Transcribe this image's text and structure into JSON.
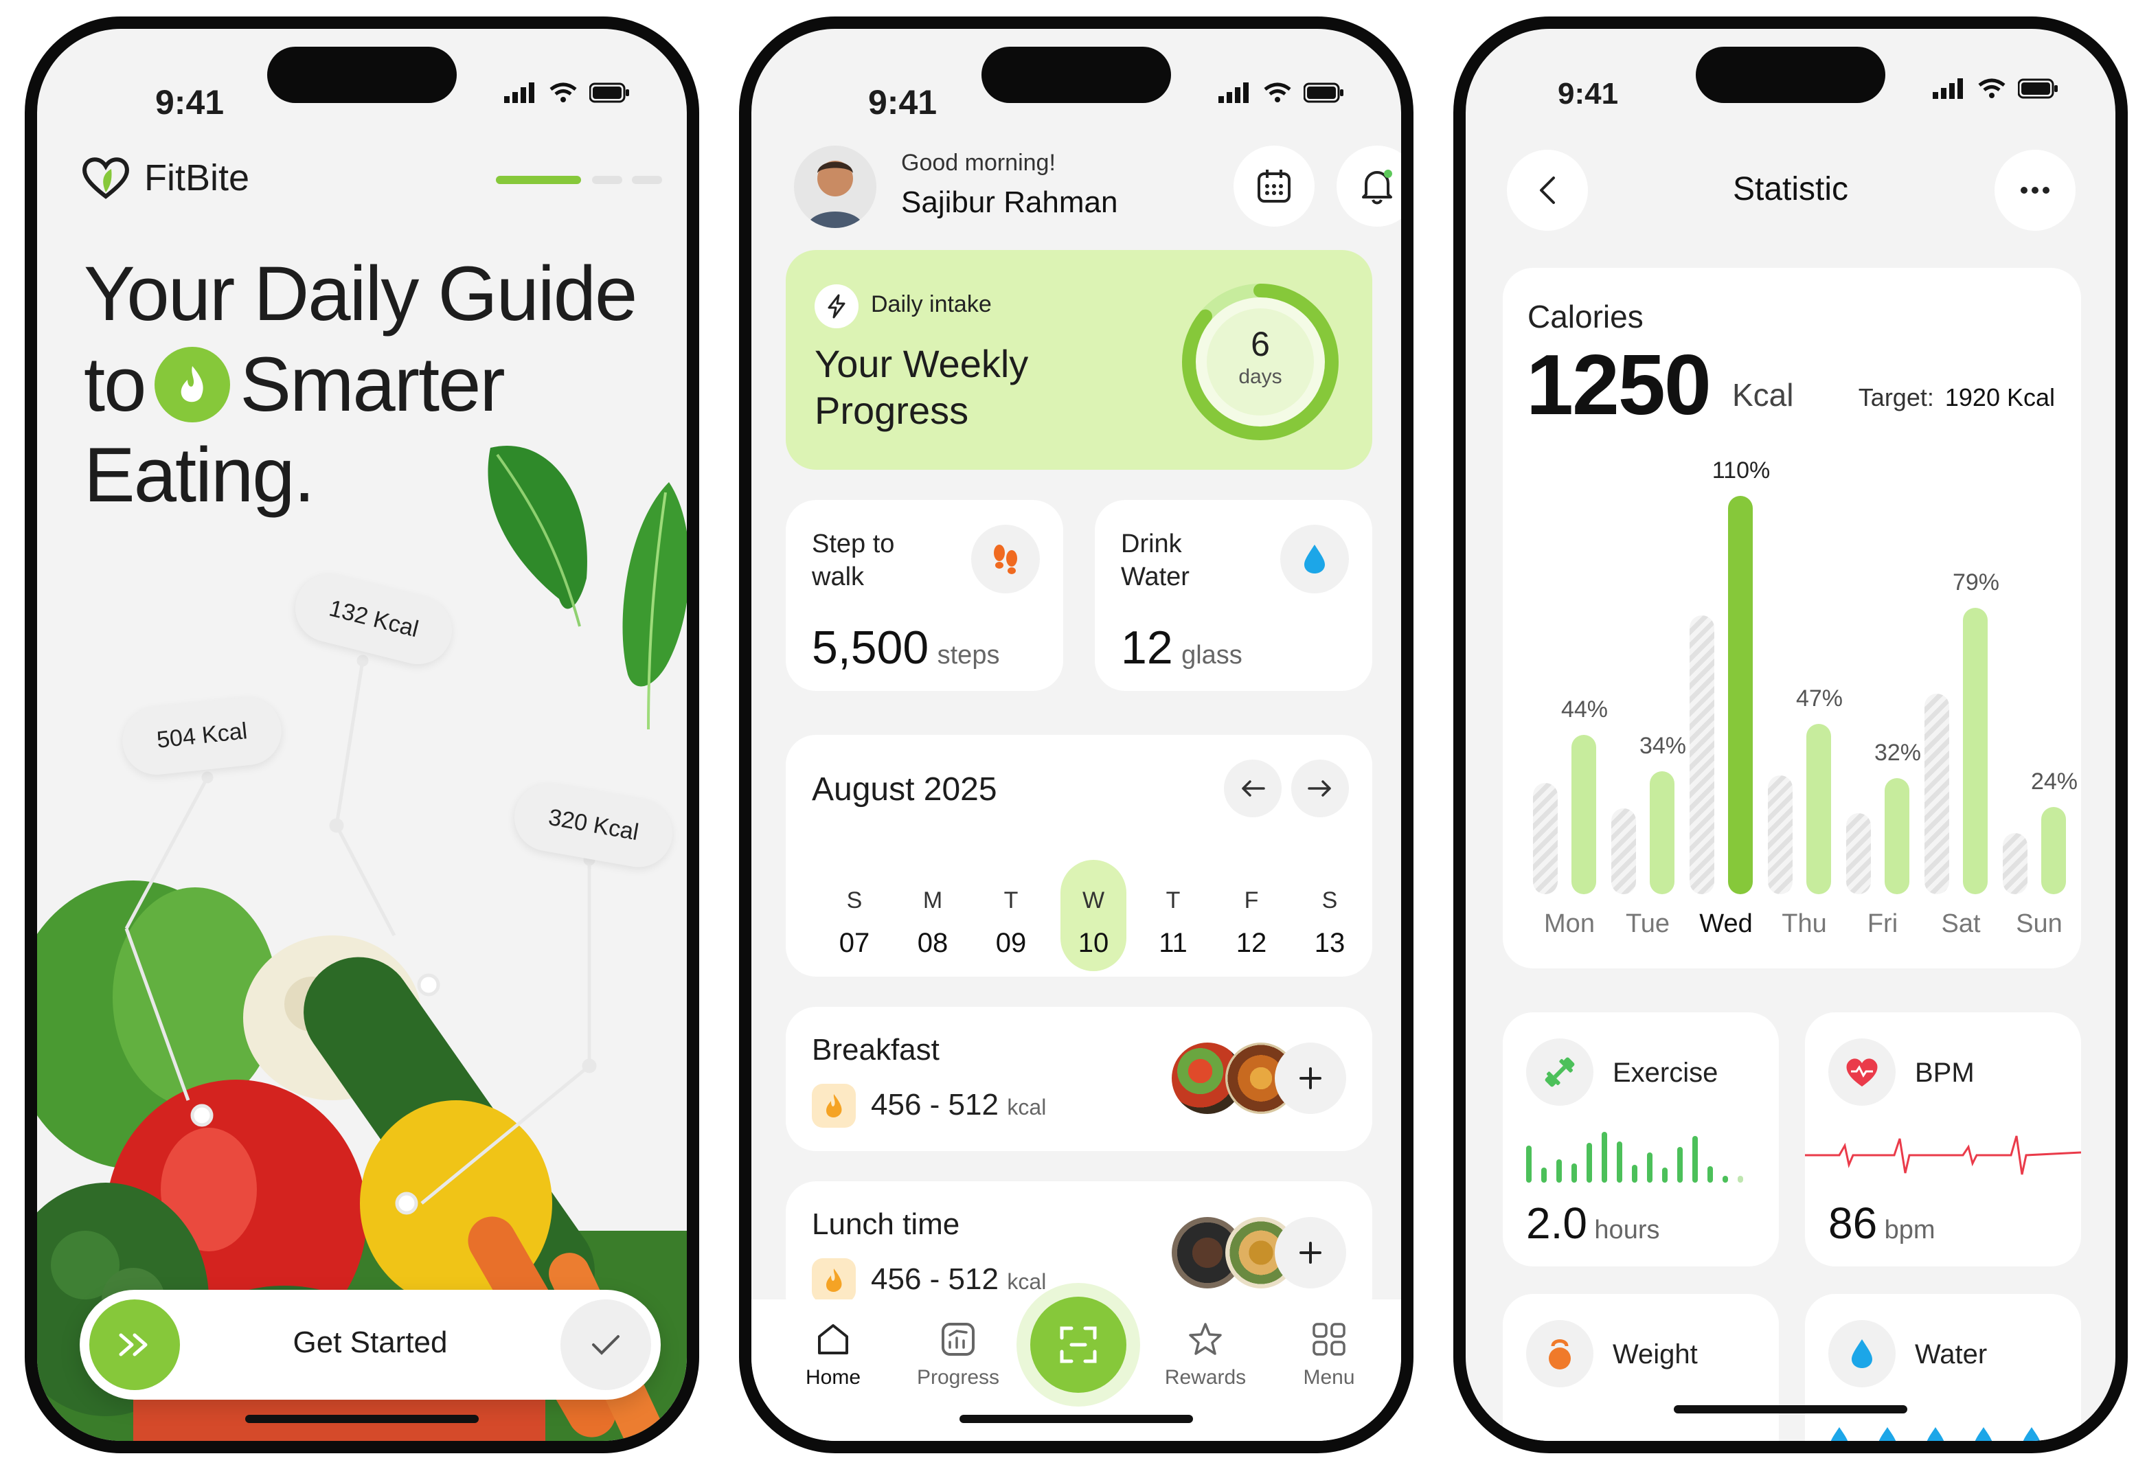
{
  "status_time": "9:41",
  "onboarding": {
    "brand": "FitBite",
    "headline_line1": "Your Daily Guide",
    "headline_to": "to",
    "headline_smarter": "Smarter",
    "headline_line3": "Eating.",
    "kcal_tags": [
      "132 Kcal",
      "504 Kcal",
      "320 Kcal"
    ],
    "cta_label": "Get Started"
  },
  "home": {
    "greeting": "Good morning!",
    "user_name": "Sajibur Rahman",
    "intake_label": "Daily intake",
    "intake_title_line1": "Your Weekly",
    "intake_title_line2": "Progress",
    "ring_value": "6",
    "ring_unit": "days",
    "ring_fraction": 0.86,
    "steps_title_line1": "Step to",
    "steps_title_line2": "walk",
    "steps_value": "5,500",
    "steps_unit": "steps",
    "water_title_line1": "Drink",
    "water_title_line2": "Water",
    "water_value": "12",
    "water_unit": "glass",
    "calendar_month": "August 2025",
    "calendar_days": [
      {
        "l": "S",
        "n": "07"
      },
      {
        "l": "M",
        "n": "08"
      },
      {
        "l": "T",
        "n": "09"
      },
      {
        "l": "W",
        "n": "10"
      },
      {
        "l": "T",
        "n": "11"
      },
      {
        "l": "F",
        "n": "12"
      },
      {
        "l": "S",
        "n": "13"
      }
    ],
    "selected_day": "10",
    "meals": [
      {
        "title": "Breakfast",
        "range": "456 - 512",
        "unit": "kcal"
      },
      {
        "title": "Lunch time",
        "range": "456 - 512",
        "unit": "kcal"
      }
    ],
    "nav": {
      "home": "Home",
      "progress": "Progress",
      "rewards": "Rewards",
      "menu": "Menu"
    }
  },
  "statistic": {
    "title": "Statistic",
    "calories_label": "Calories",
    "calories_value": "1250",
    "calories_unit": "Kcal",
    "target_label": "Target:",
    "target_value": "1920 Kcal",
    "exercise_label": "Exercise",
    "exercise_value": "2.0",
    "exercise_unit": "hours",
    "bpm_label": "BPM",
    "bpm_value": "86",
    "bpm_unit": "bpm",
    "weight_label": "Weight",
    "water_label": "Water"
  },
  "chart_data": {
    "type": "bar",
    "categories": [
      "Mon",
      "Tue",
      "Wed",
      "Thu",
      "Fri",
      "Sat",
      "Sun"
    ],
    "values": [
      44,
      34,
      110,
      47,
      32,
      79,
      24
    ],
    "labels": [
      "44%",
      "34%",
      "110%",
      "47%",
      "32%",
      "79%",
      "24%"
    ],
    "highlight": "Wed",
    "colors": {
      "bar": "#c7ec9d",
      "highlight": "#86c83a"
    }
  },
  "colors": {
    "accent": "#86c83a",
    "accent_light": "#dcf3b4",
    "ink": "#1d1d1d"
  }
}
